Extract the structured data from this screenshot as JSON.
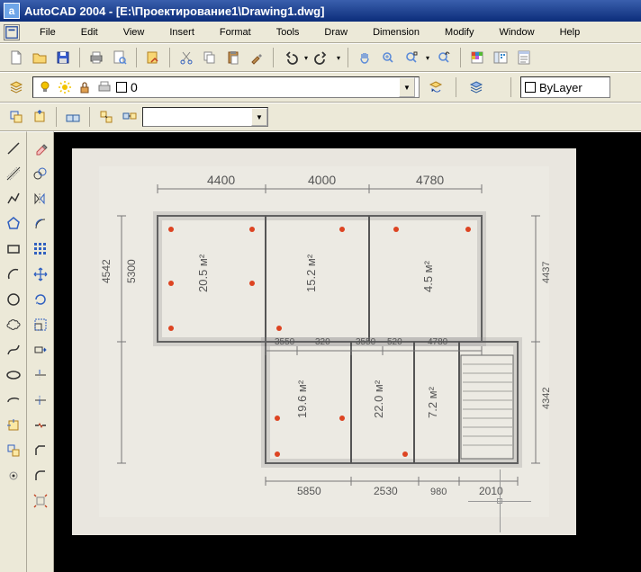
{
  "title": "AutoCAD 2004 - [E:\\Проектирование1\\Drawing1.dwg]",
  "menus": [
    "File",
    "Edit",
    "View",
    "Insert",
    "Format",
    "Tools",
    "Draw",
    "Dimension",
    "Modify",
    "Window",
    "Help"
  ],
  "layer": {
    "current": "0",
    "bylayer": "ByLayer"
  },
  "colors": {
    "bulb": "#f2c300",
    "sun": "#f2c300",
    "lock": "#e0a050",
    "new": "#fff",
    "save": "#3b5fcf",
    "print": "#9b6f3a",
    "cut": "#808080",
    "copy": "#c08030",
    "paste": "#c08030",
    "undo": "#333",
    "redo": "#333"
  },
  "sketch_labels": {
    "top": [
      "4400",
      "4000",
      "4780"
    ],
    "left": [
      "4542",
      "5300"
    ],
    "rooms": [
      "20.5 м²",
      "15.2 м²",
      "4.5 м²",
      "19.6 м²",
      "22.0 м²",
      "7.2 м²"
    ],
    "mid": [
      "3550",
      "320",
      "3550",
      "520",
      "4780"
    ],
    "bottom": [
      "5850",
      "2530",
      "980",
      "2010"
    ],
    "right": [
      "4437",
      "4342"
    ]
  }
}
